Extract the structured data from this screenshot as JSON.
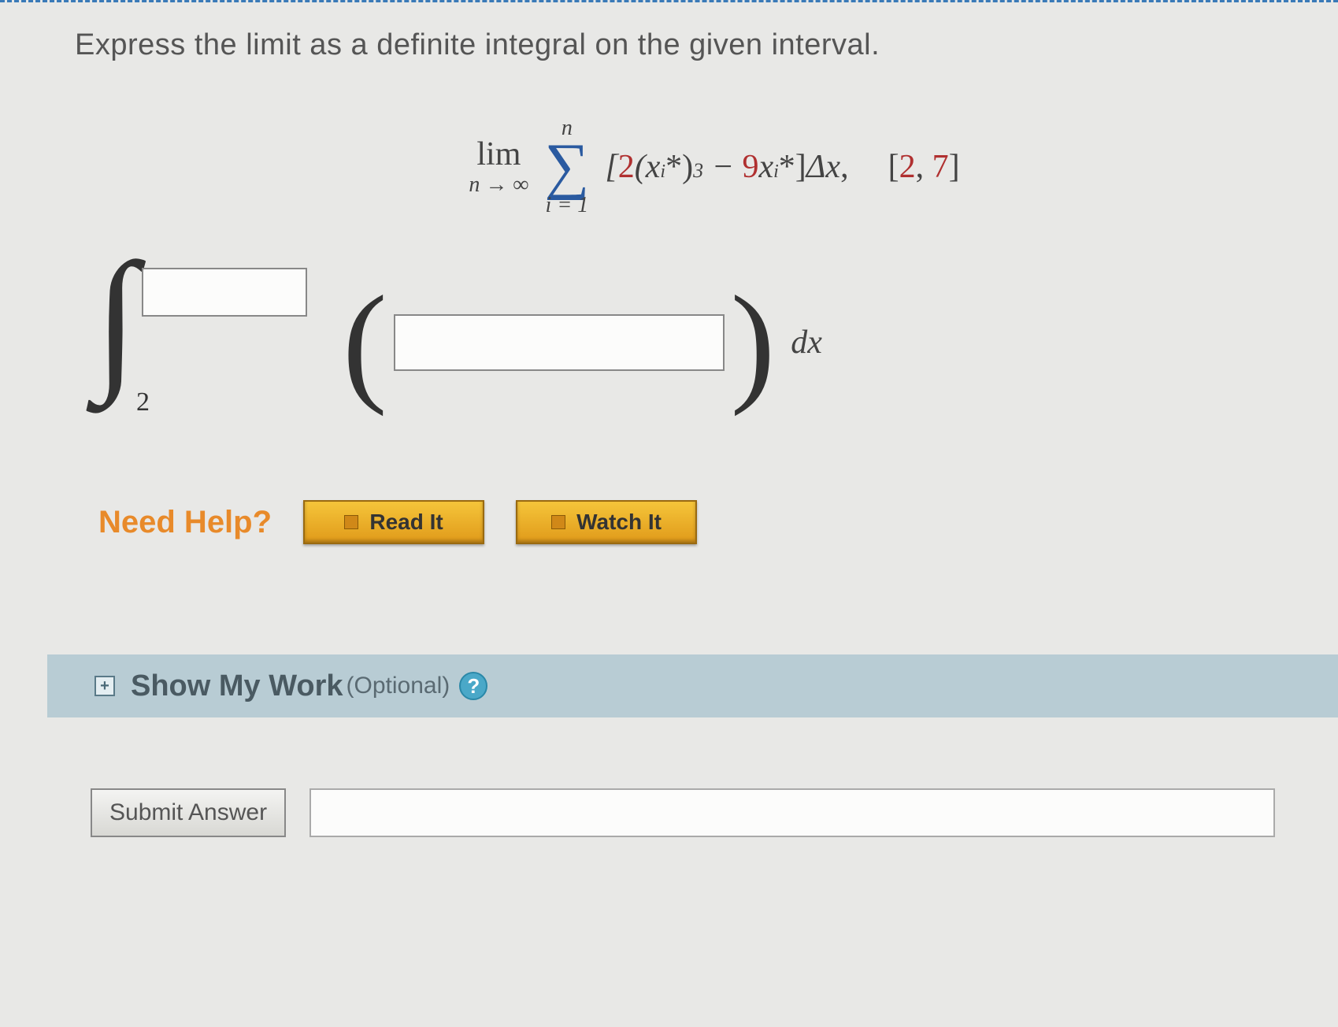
{
  "question": "Express the limit as a definite integral on the given interval.",
  "math": {
    "lim": "lim",
    "lim_sub": "n → ∞",
    "sigma_top": "n",
    "sigma_bottom": "i = 1",
    "coef1": "2",
    "exponent": "3",
    "coef2": "9",
    "interval_open": "[",
    "interval_a": "2",
    "interval_sep": ", ",
    "interval_b": "7",
    "interval_close": "]"
  },
  "integral": {
    "lower": "2",
    "dx": "dx"
  },
  "help": {
    "label": "Need Help?",
    "read": "Read It",
    "watch": "Watch It"
  },
  "smw": {
    "title": "Show My Work",
    "optional": "(Optional)",
    "q": "?"
  },
  "submit": {
    "label": "Submit Answer"
  }
}
